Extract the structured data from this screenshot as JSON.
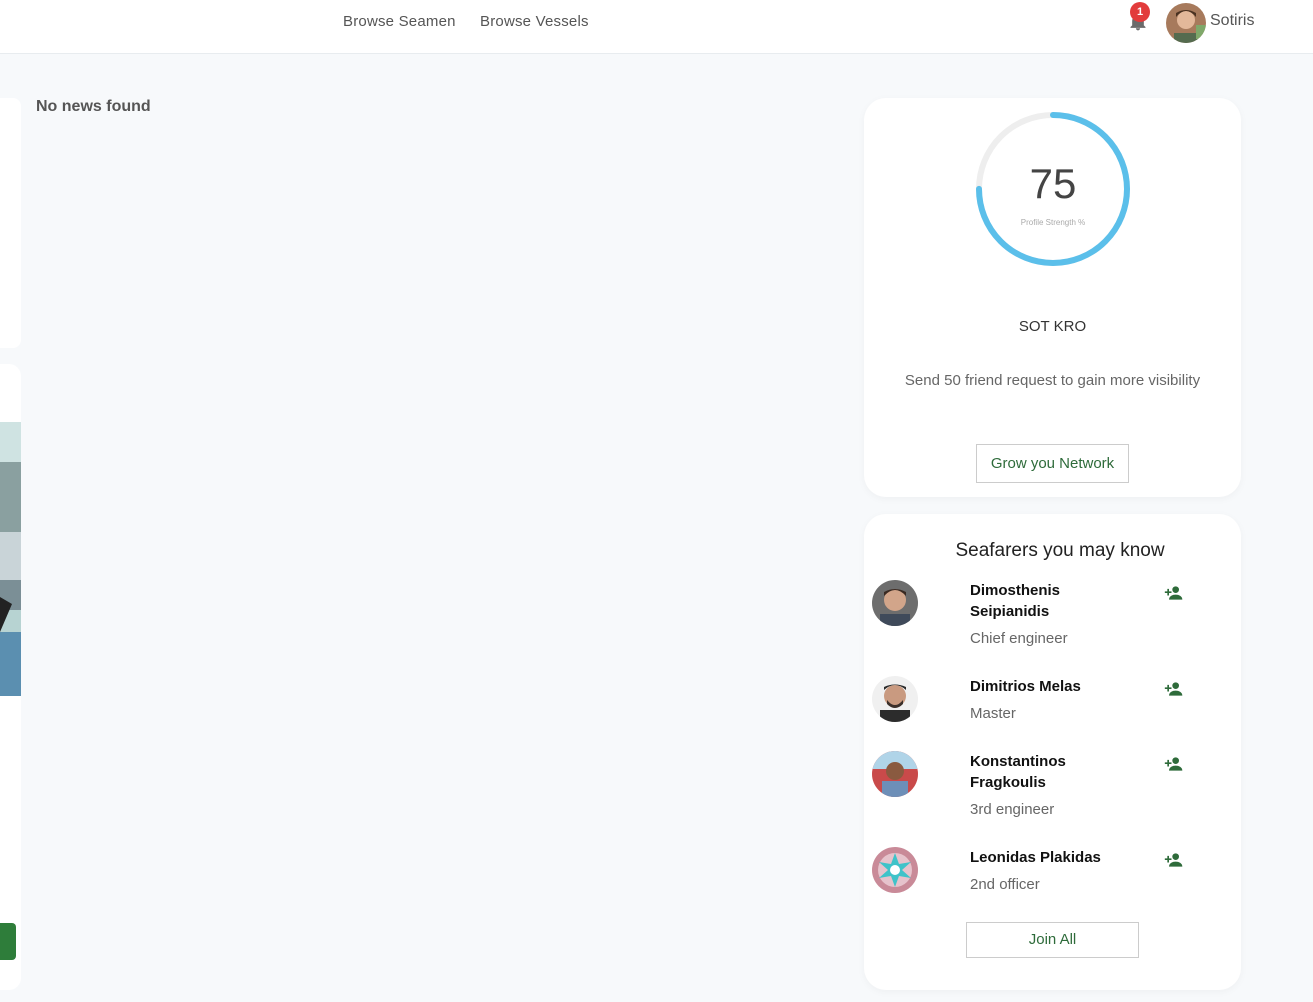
{
  "nav": {
    "links": [
      "Browse Seamen",
      "Browse Vessels"
    ],
    "notification_count": "1",
    "user_name": "Sotiris"
  },
  "feed": {
    "empty_message": "No news found"
  },
  "profile": {
    "strength_value": "75",
    "strength_fraction": 0.75,
    "strength_label": "Profile Strength %",
    "name": "SOT KRO",
    "message": "Send 50 friend request to gain more visibility",
    "grow_button": "Grow you Network",
    "ring_color": "#5bbfea"
  },
  "suggestions": {
    "title": "Seafarers you may know",
    "people": [
      {
        "name": "Dimosthenis Seipianidis",
        "role": "Chief engineer"
      },
      {
        "name": "Dimitrios Melas",
        "role": "Master"
      },
      {
        "name": "Konstantinos Fragkoulis",
        "role": "3rd engineer"
      },
      {
        "name": "Leonidas Plakidas",
        "role": "2nd officer"
      }
    ],
    "join_button": "Join All"
  },
  "colors": {
    "accent_green": "#2e6b3a",
    "badge_red": "#e23b3b"
  }
}
